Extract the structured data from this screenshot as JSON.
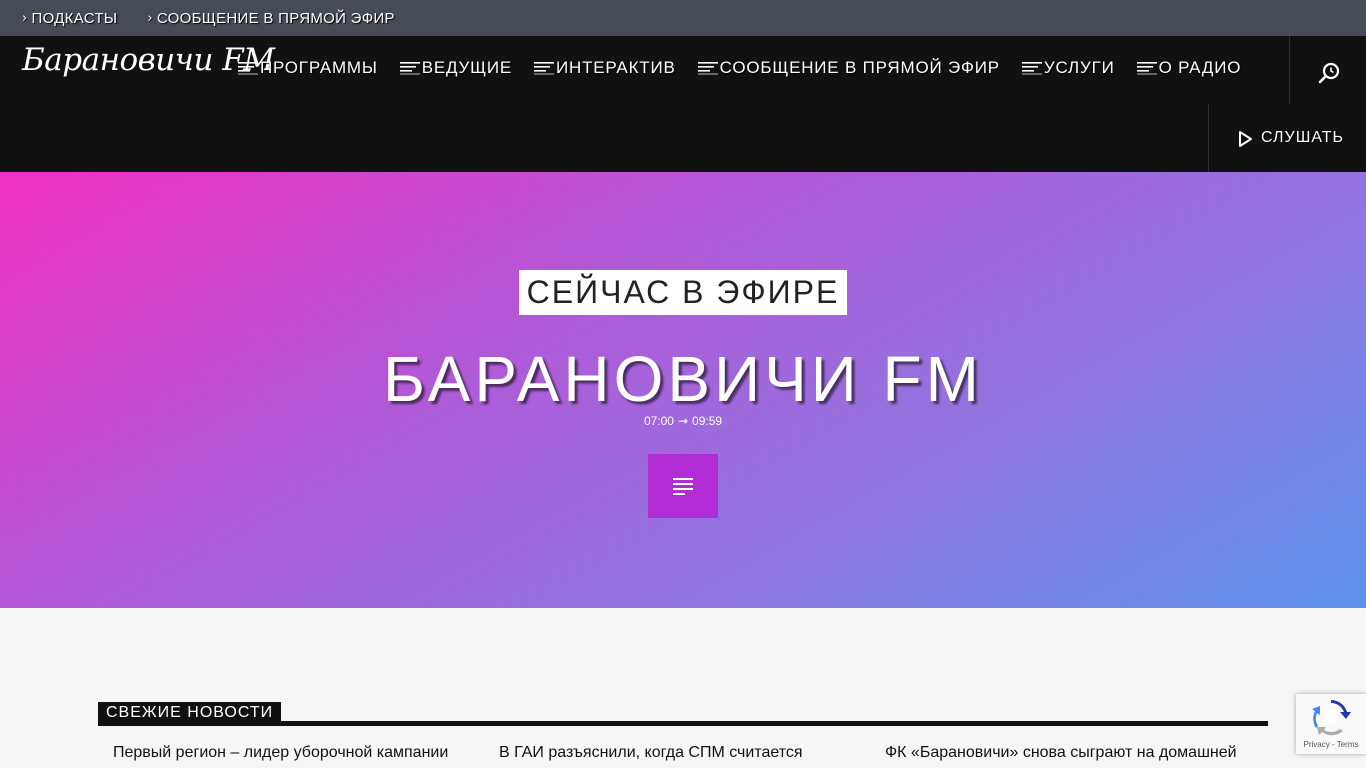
{
  "topbar": {
    "links": [
      {
        "label": "ПОДКАСТЫ"
      },
      {
        "label": "СООБЩЕНИЕ В ПРЯМОЙ ЭФИР"
      }
    ]
  },
  "header": {
    "logo_text": "Барановичи FM",
    "nav": [
      {
        "label": "ПРОГРАММЫ"
      },
      {
        "label": "ВЕДУЩИЕ"
      },
      {
        "label": "ИНТЕРАКТИВ"
      },
      {
        "label": "СООБЩЕНИЕ В ПРЯМОЙ ЭФИР"
      },
      {
        "label": "УСЛУГИ"
      },
      {
        "label": "О РАДИО"
      }
    ],
    "listen_label": "СЛУШАТЬ"
  },
  "hero": {
    "onair_label": "СЕЙЧАС В ЭФИРЕ",
    "show_title": "БАРАНОВИЧИ FM",
    "time_start": "07:00",
    "time_end": "09:59"
  },
  "news": {
    "heading": "СВЕЖИЕ НОВОСТИ",
    "items": [
      {
        "title": "Первый регион – лидер уборочной кампании"
      },
      {
        "title": "В ГАИ разъяснили, когда СПМ считается"
      },
      {
        "title": "ФК «Барановичи» снова сыграют на домашней"
      }
    ]
  },
  "recaptcha": {
    "links": "Privacy - Terms"
  },
  "colors": {
    "topbar_bg": "#474b56",
    "header_bg": "#111111",
    "accent_purple": "#b22cd6",
    "hero_gradient_start": "#f02fc2",
    "hero_gradient_end": "#5c93ea"
  }
}
